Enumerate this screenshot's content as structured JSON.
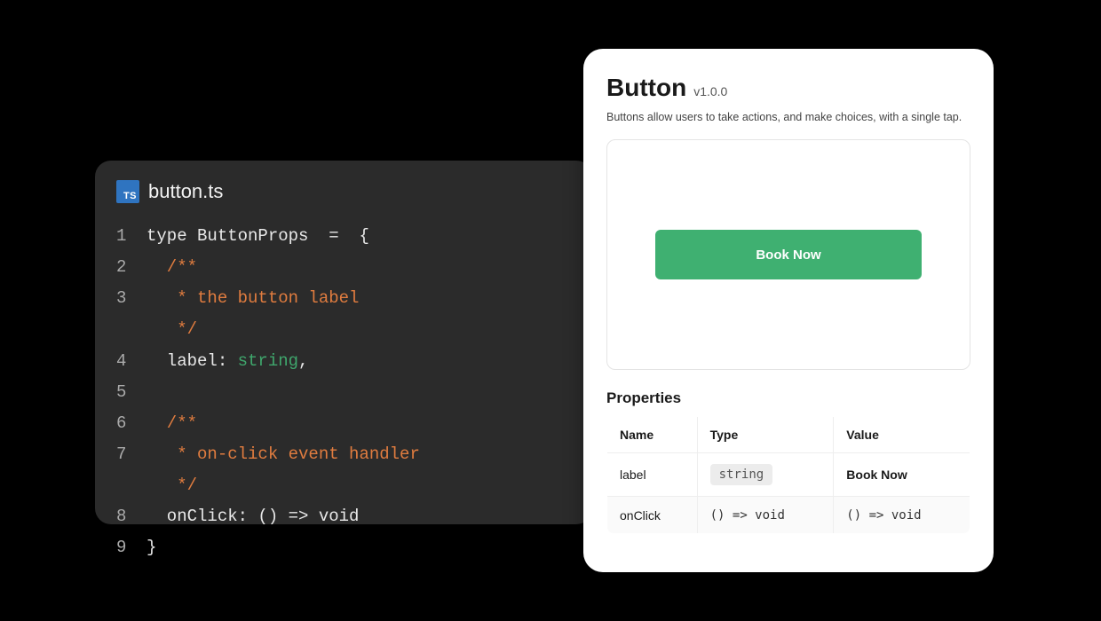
{
  "editor": {
    "file_icon": "TS",
    "filename": "button.ts",
    "lines": [
      {
        "n": 1,
        "segments": [
          {
            "t": "type ",
            "c": "tok-kw"
          },
          {
            "t": "ButtonProps  ",
            "c": "tok-type"
          },
          {
            "t": "=  {",
            "c": "tok-punc"
          }
        ]
      },
      {
        "n": 2,
        "segments": [
          {
            "t": "  /**",
            "c": "tok-comment"
          }
        ]
      },
      {
        "n": 3,
        "segments": [
          {
            "t": "   * the button label",
            "c": "tok-comment"
          }
        ]
      },
      {
        "n": "",
        "segments": [
          {
            "t": "   */",
            "c": "tok-comment"
          }
        ]
      },
      {
        "n": 4,
        "segments": [
          {
            "t": "  label: ",
            "c": "tok-prop"
          },
          {
            "t": "string",
            "c": "tok-str"
          },
          {
            "t": ",",
            "c": "tok-punc"
          }
        ]
      },
      {
        "n": 5,
        "segments": [
          {
            "t": " ",
            "c": "tok-punc"
          }
        ]
      },
      {
        "n": 6,
        "segments": [
          {
            "t": "  /**",
            "c": "tok-comment"
          }
        ]
      },
      {
        "n": 7,
        "segments": [
          {
            "t": "   * on-click event handler",
            "c": "tok-comment"
          }
        ]
      },
      {
        "n": "",
        "segments": [
          {
            "t": "   */",
            "c": "tok-comment"
          }
        ]
      },
      {
        "n": 8,
        "segments": [
          {
            "t": "  onClick: () => void",
            "c": "tok-prop"
          }
        ]
      },
      {
        "n": 9,
        "segments": [
          {
            "t": "}",
            "c": "tok-punc"
          }
        ]
      }
    ]
  },
  "card": {
    "title": "Button",
    "version": "v1.0.0",
    "description": "Buttons allow users to take actions, and make choices, with a single tap.",
    "demo_button_label": "Book Now",
    "properties_heading": "Properties",
    "columns": {
      "name": "Name",
      "type": "Type",
      "value": "Value"
    },
    "rows": [
      {
        "name": "label",
        "type": "string",
        "type_is_chip": true,
        "value": "Book Now",
        "value_strong": true
      },
      {
        "name": "onClick",
        "type": "() => void",
        "type_is_chip": false,
        "value": "() => void",
        "value_strong": false
      }
    ]
  }
}
